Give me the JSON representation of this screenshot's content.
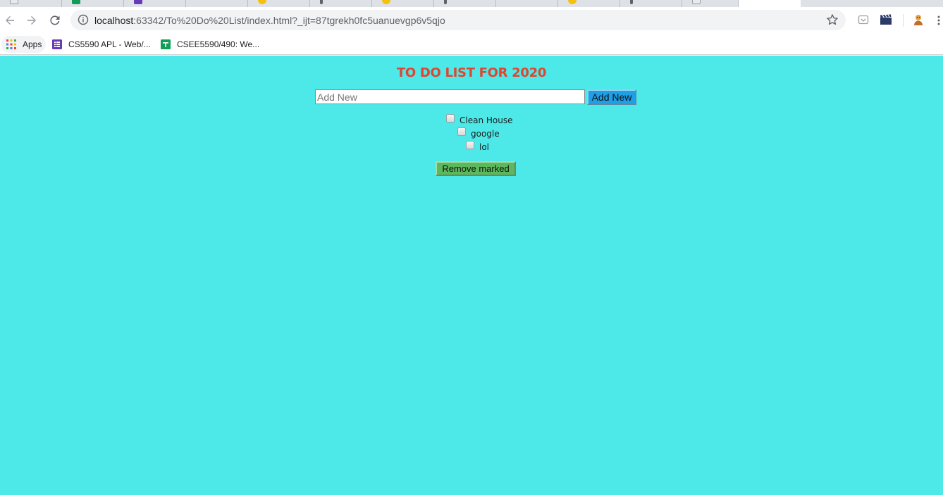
{
  "browser": {
    "url_host": "localhost",
    "url_rest": ":63342/To%20Do%20List/index.html?_ijt=87tgrekh0fc5uanuevgp6v5qjo",
    "bookmarks": [
      {
        "label": "Apps",
        "icon": "apps-grid-icon"
      },
      {
        "label": "CS5590 APL - Web/...",
        "icon": "forms-icon"
      },
      {
        "label": "CSEE5590/490: We...",
        "icon": "sheets-icon"
      }
    ]
  },
  "page": {
    "title": "TO DO LIST FOR 2020",
    "add_input_placeholder": "Add New",
    "add_input_value": "",
    "add_button_label": "Add New",
    "items": [
      {
        "label": "Clean House",
        "checked": false
      },
      {
        "label": "google",
        "checked": false
      },
      {
        "label": "lol",
        "checked": false
      }
    ],
    "remove_button_label": "Remove marked"
  },
  "colors": {
    "page_background": "#4de8e8",
    "title": "#e0452f",
    "add_button": "#1e9fe6",
    "remove_button": "#5cb85c"
  }
}
